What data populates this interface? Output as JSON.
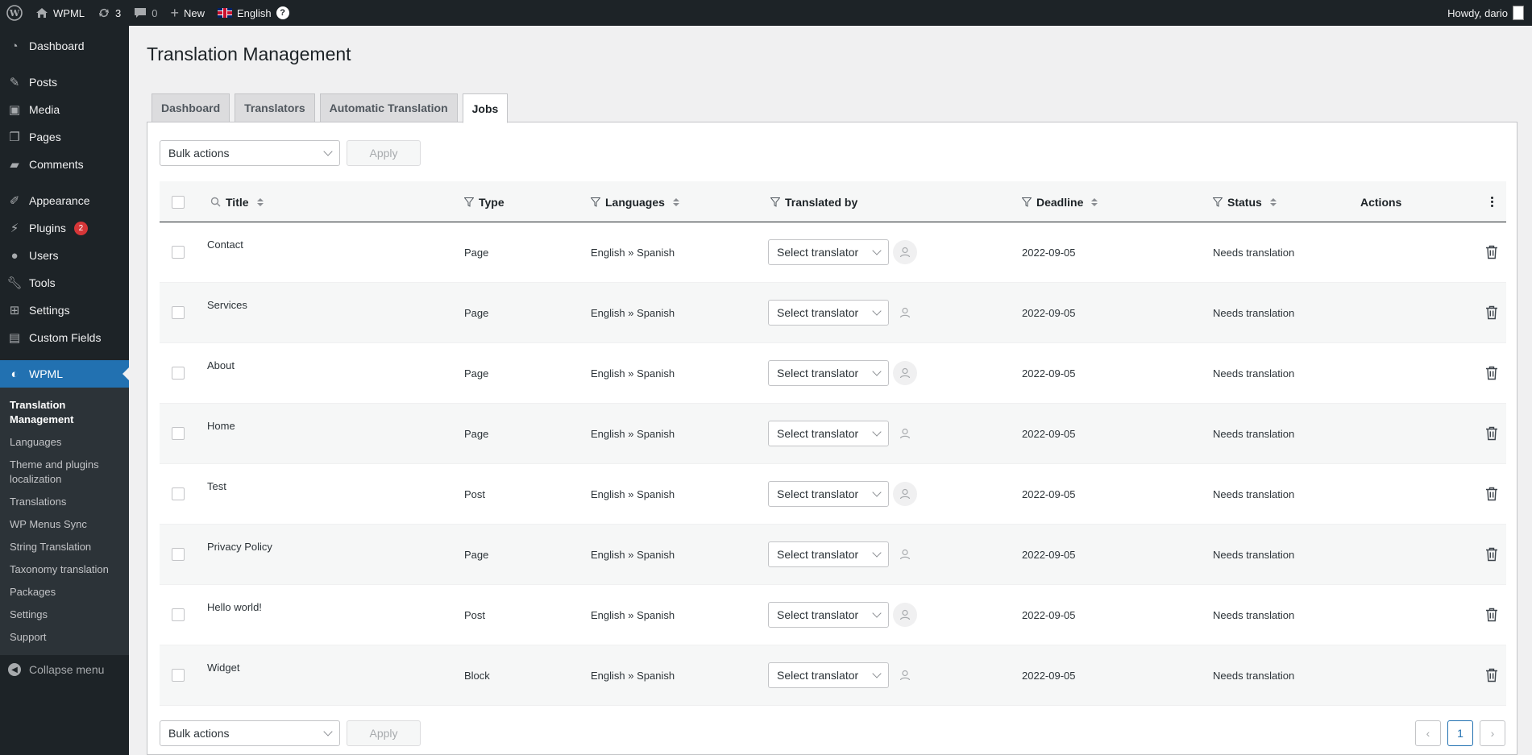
{
  "adminbar": {
    "site_name": "WPML",
    "updates_count": "3",
    "comments_count": "0",
    "new_label": "New",
    "language": "English",
    "help_icon_text": "?",
    "howdy": "Howdy, dario"
  },
  "sidebar": {
    "items": [
      {
        "label": "Dashboard",
        "icon": "dashboard-icon"
      },
      {
        "label": "Posts",
        "icon": "pin-icon"
      },
      {
        "label": "Media",
        "icon": "media-icon"
      },
      {
        "label": "Pages",
        "icon": "pages-icon"
      },
      {
        "label": "Comments",
        "icon": "comment-icon"
      },
      {
        "label": "Appearance",
        "icon": "brush-icon"
      },
      {
        "label": "Plugins",
        "icon": "plugin-icon",
        "badge": "2"
      },
      {
        "label": "Users",
        "icon": "user-icon"
      },
      {
        "label": "Tools",
        "icon": "wrench-icon"
      },
      {
        "label": "Settings",
        "icon": "settings-icon"
      },
      {
        "label": "Custom Fields",
        "icon": "table-icon"
      },
      {
        "label": "WPML",
        "icon": "wpml-icon"
      }
    ],
    "submenu": [
      "Translation Management",
      "Languages",
      "Theme and plugins localization",
      "Translations",
      "WP Menus Sync",
      "String Translation",
      "Taxonomy translation",
      "Packages",
      "Settings",
      "Support"
    ],
    "collapse_label": "Collapse menu"
  },
  "page": {
    "title": "Translation Management",
    "tabs": [
      "Dashboard",
      "Translators",
      "Automatic Translation",
      "Jobs"
    ],
    "active_tab": "Jobs",
    "bulk_actions_label": "Bulk actions",
    "apply_label": "Apply"
  },
  "table": {
    "columns": {
      "title": "Title",
      "type": "Type",
      "languages": "Languages",
      "translated_by": "Translated by",
      "deadline": "Deadline",
      "status": "Status",
      "actions": "Actions"
    },
    "translator_placeholder": "Select translator",
    "rows": [
      {
        "title": "Contact",
        "type": "Page",
        "languages": "English » Spanish",
        "deadline": "2022-09-05",
        "status": "Needs translation"
      },
      {
        "title": "Services",
        "type": "Page",
        "languages": "English » Spanish",
        "deadline": "2022-09-05",
        "status": "Needs translation"
      },
      {
        "title": "About",
        "type": "Page",
        "languages": "English » Spanish",
        "deadline": "2022-09-05",
        "status": "Needs translation"
      },
      {
        "title": "Home",
        "type": "Page",
        "languages": "English » Spanish",
        "deadline": "2022-09-05",
        "status": "Needs translation"
      },
      {
        "title": "Test",
        "type": "Post",
        "languages": "English » Spanish",
        "deadline": "2022-09-05",
        "status": "Needs translation"
      },
      {
        "title": "Privacy Policy",
        "type": "Page",
        "languages": "English » Spanish",
        "deadline": "2022-09-05",
        "status": "Needs translation"
      },
      {
        "title": "Hello world!",
        "type": "Post",
        "languages": "English » Spanish",
        "deadline": "2022-09-05",
        "status": "Needs translation"
      },
      {
        "title": "Widget",
        "type": "Block",
        "languages": "English » Spanish",
        "deadline": "2022-09-05",
        "status": "Needs translation"
      }
    ]
  },
  "pagination": {
    "prev": "‹",
    "current": "1",
    "next": "›"
  },
  "colors": {
    "admin_dark": "#1d2327",
    "accent": "#2271b1",
    "badge": "#d63638"
  }
}
